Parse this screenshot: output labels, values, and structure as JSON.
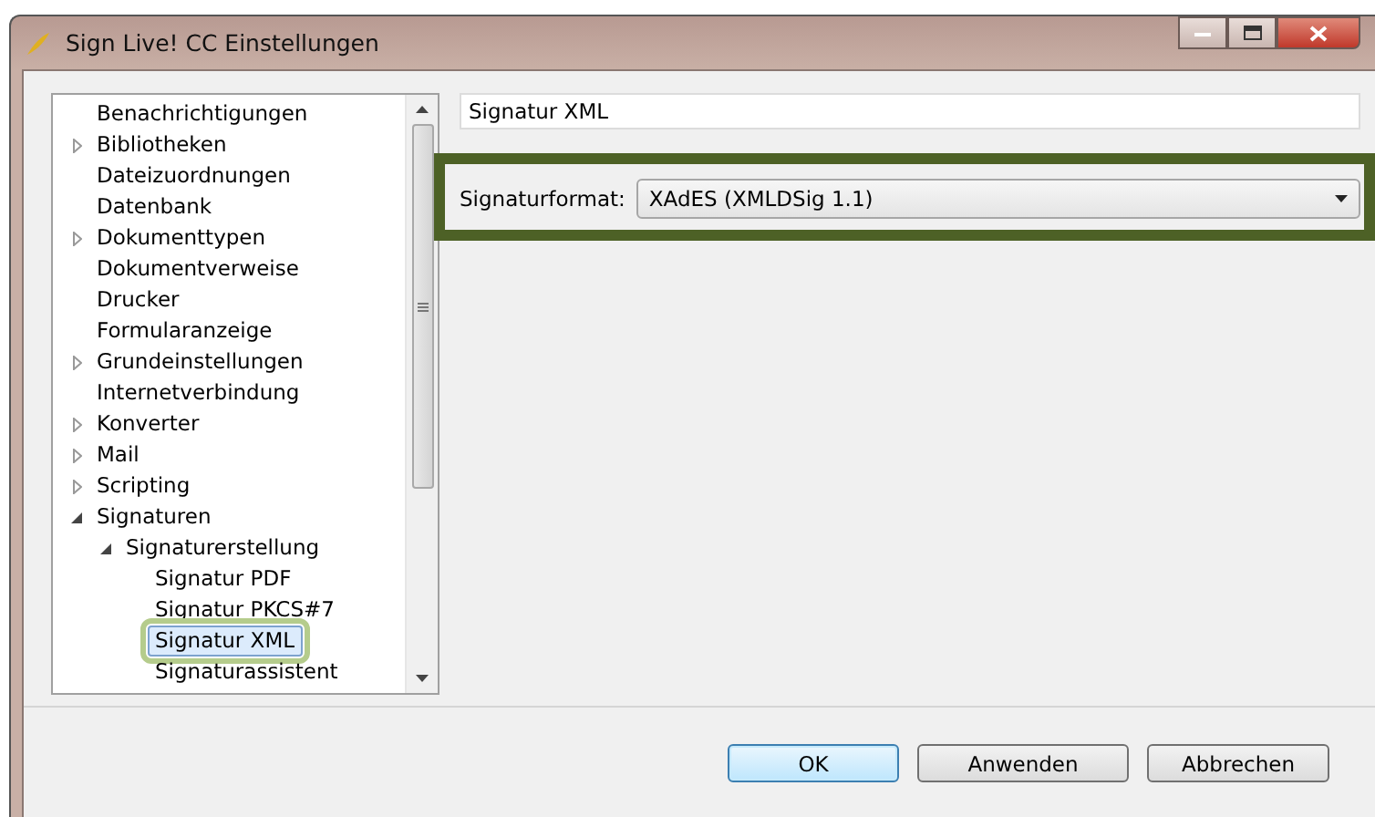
{
  "window": {
    "title": "Sign Live! CC Einstellungen"
  },
  "tree": [
    {
      "label": "Benachrichtigungen",
      "selected": false
    },
    {
      "label": "Bibliotheken",
      "selected": false,
      "expanded": false
    },
    {
      "label": "Dateizuordnungen",
      "selected": false
    },
    {
      "label": "Datenbank",
      "selected": false
    },
    {
      "label": "Dokumenttypen",
      "selected": false,
      "expanded": false
    },
    {
      "label": "Dokumentverweise",
      "selected": false
    },
    {
      "label": "Drucker",
      "selected": false
    },
    {
      "label": "Formularanzeige",
      "selected": false
    },
    {
      "label": "Grundeinstellungen",
      "selected": false,
      "expanded": false
    },
    {
      "label": "Internetverbindung",
      "selected": false
    },
    {
      "label": "Konverter",
      "selected": false,
      "expanded": false
    },
    {
      "label": "Mail",
      "selected": false,
      "expanded": false
    },
    {
      "label": "Scripting",
      "selected": false,
      "expanded": false
    },
    {
      "label": "Signaturen",
      "selected": false,
      "expanded": true,
      "children": [
        {
          "label": "Signaturerstellung",
          "selected": false,
          "expanded": true,
          "children": [
            {
              "label": "Signatur PDF",
              "selected": false
            },
            {
              "label": "Signatur PKCS#7",
              "selected": false
            },
            {
              "label": "Signatur XML",
              "selected": true
            },
            {
              "label": "Signaturassistent",
              "selected": false
            }
          ]
        }
      ]
    }
  ],
  "panel": {
    "heading": "Signatur XML",
    "format_label": "Signaturformat:",
    "format_value": "XAdES (XMLDSig 1.1)"
  },
  "buttons": [
    {
      "label": "OK",
      "default": true
    },
    {
      "label": "Anwenden",
      "default": false
    },
    {
      "label": "Abbrechen",
      "default": false
    }
  ]
}
